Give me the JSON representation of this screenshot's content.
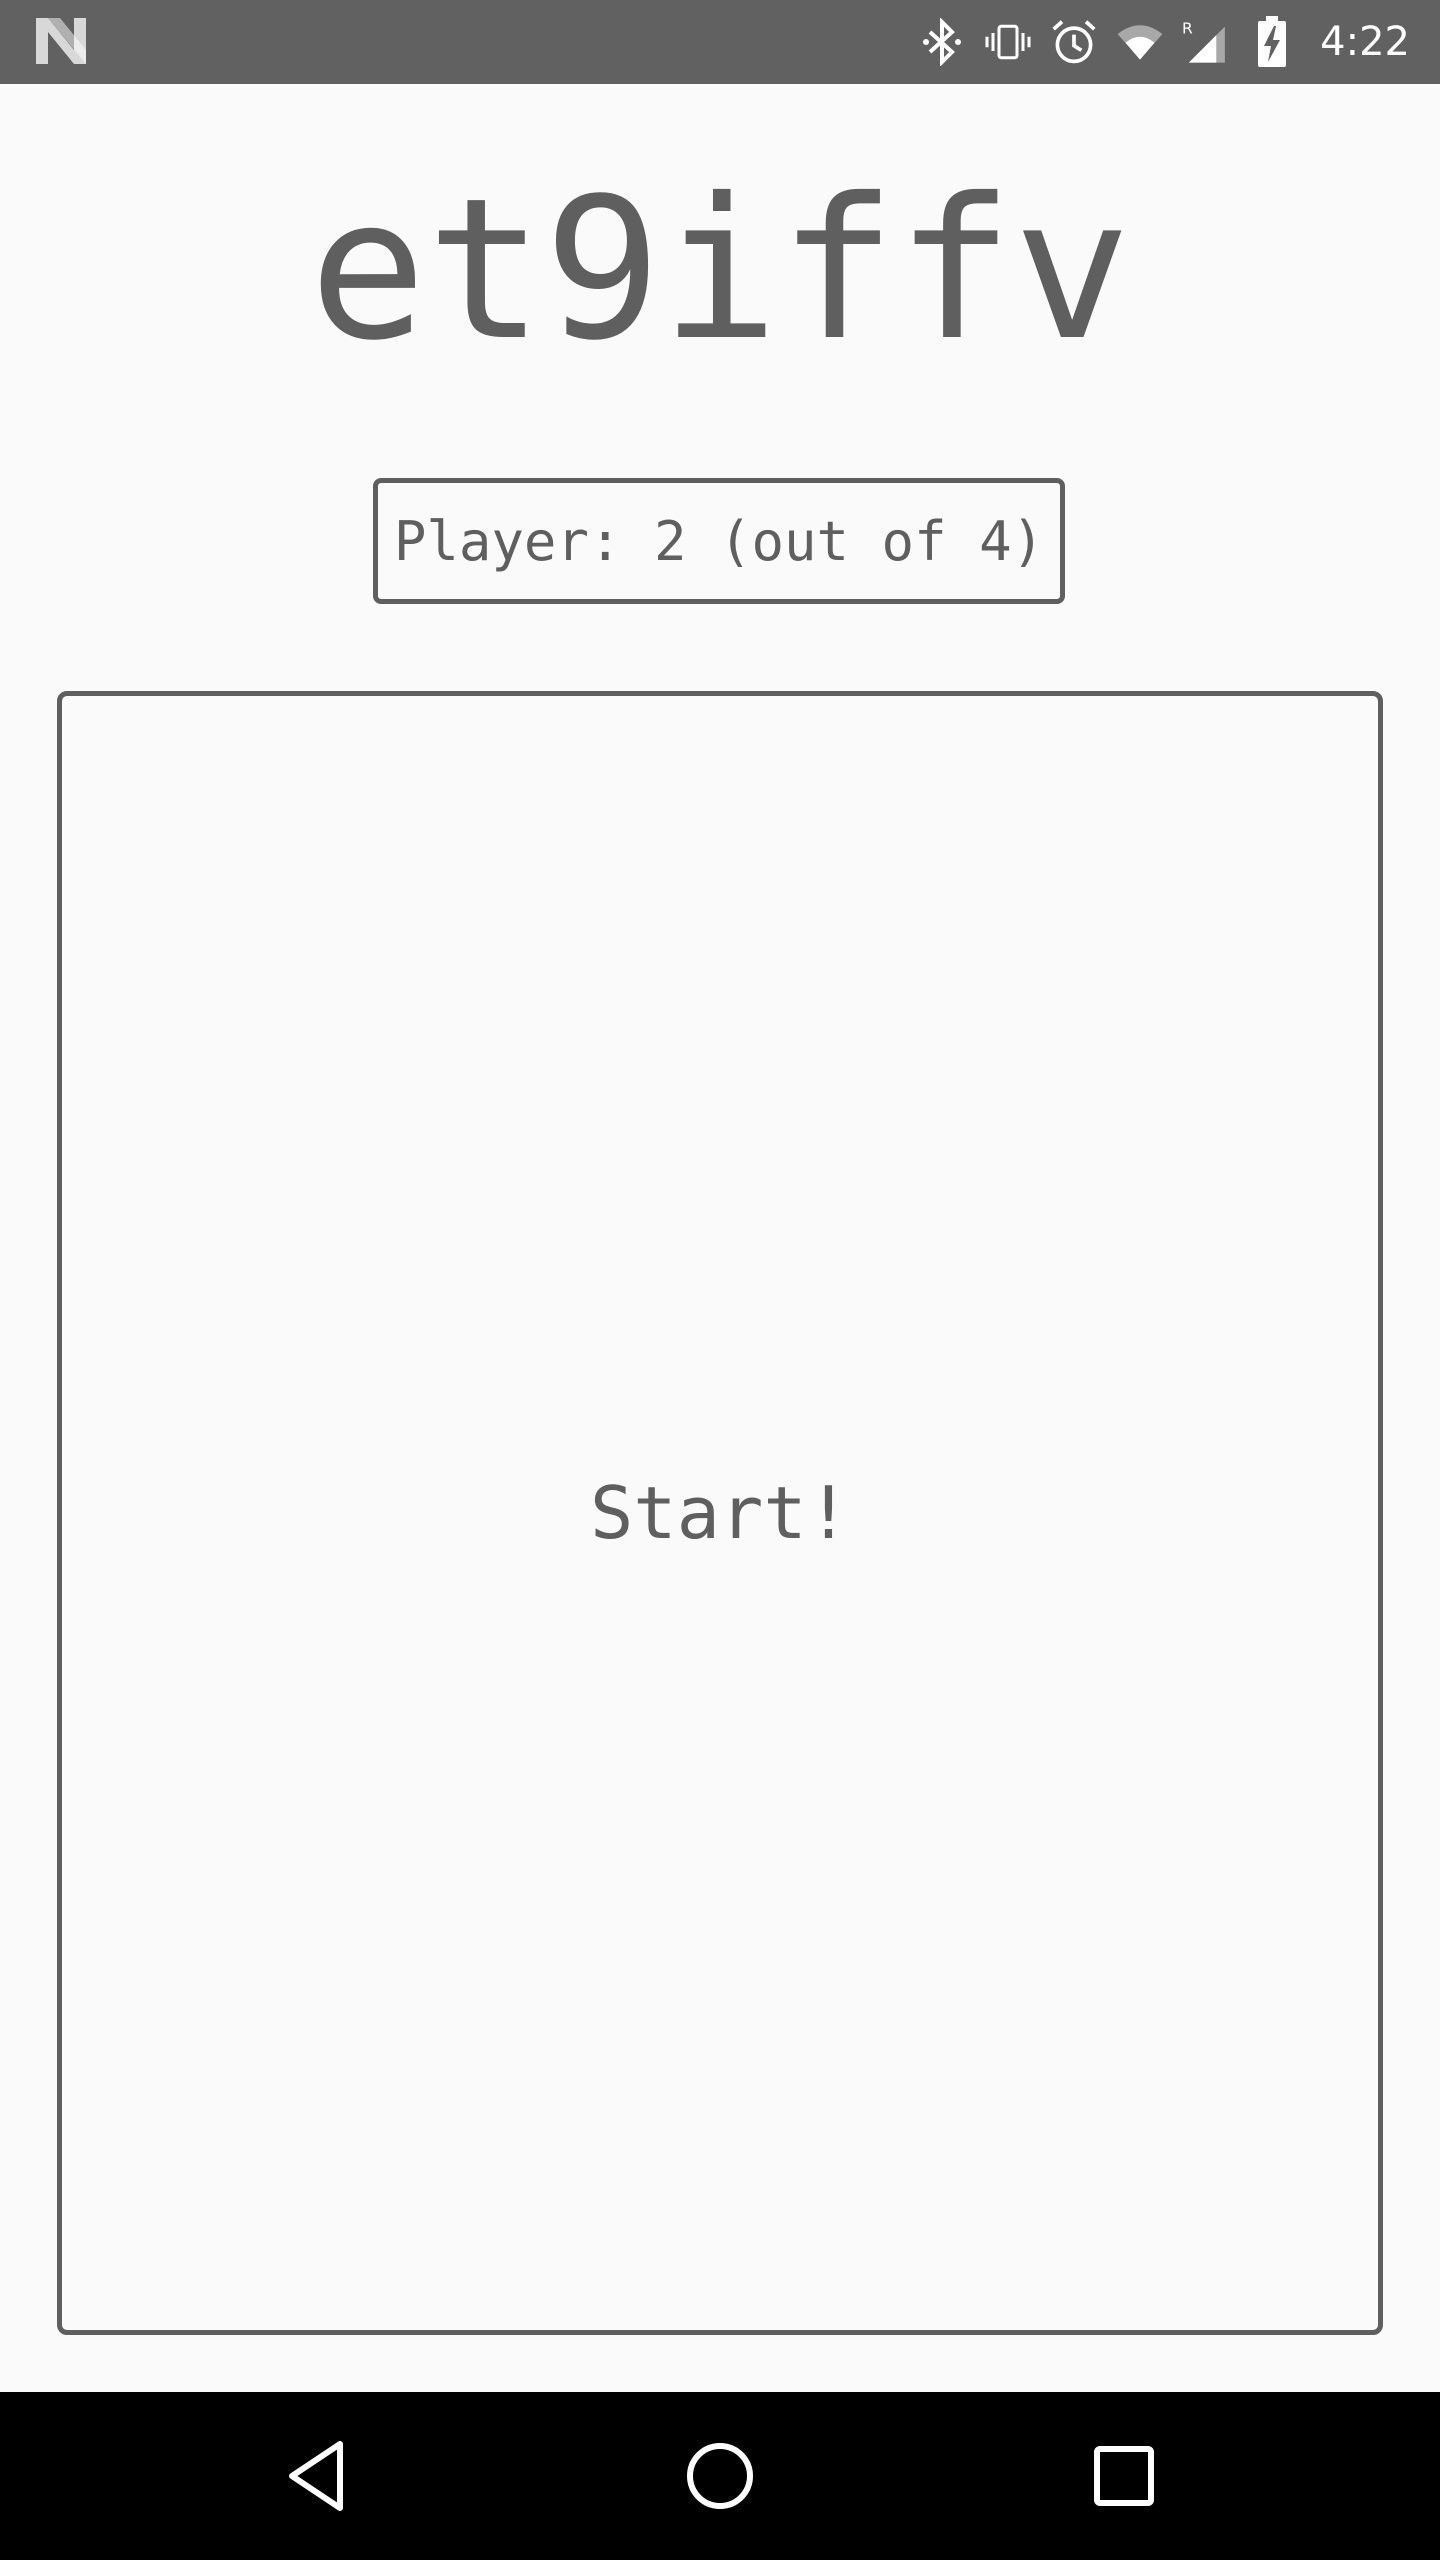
{
  "status_bar": {
    "time": "4:22",
    "icons": [
      "android-n-logo",
      "bluetooth-icon",
      "vibrate-icon",
      "alarm-icon",
      "wifi-icon",
      "signal-roaming-icon",
      "battery-charging-icon"
    ],
    "roaming_label": "R"
  },
  "game": {
    "title": "et9iffv",
    "player_label": "Player: 2 (out of 4)",
    "start_label": "Start!"
  },
  "nav_bar": {
    "buttons": [
      "back-icon",
      "home-icon",
      "recents-icon"
    ]
  },
  "colors": {
    "status_bar_bg": "#616161",
    "text": "#5f5f5f",
    "background": "#fafafa",
    "nav_bar_bg": "#000000"
  }
}
